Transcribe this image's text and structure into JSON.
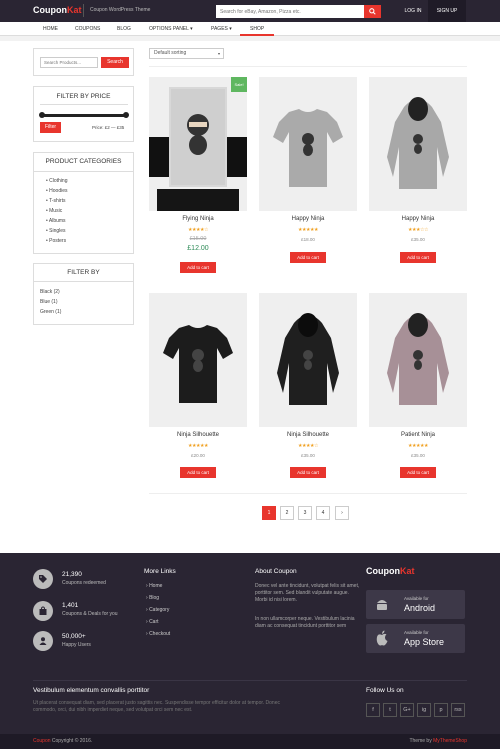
{
  "header": {
    "logo_main": "Coupon",
    "logo_accent": "Kat",
    "tagline": "Coupon WordPress Theme",
    "search_placeholder": "Search for eBay, Amazon, Pizza etc.",
    "login": "LOG IN",
    "signup": "SIGN UP",
    "accent_color": "#e8352d"
  },
  "nav": {
    "items": [
      "HOME",
      "COUPONS",
      "BLOG",
      "OPTIONS PANEL ▾",
      "PAGES ▾",
      "SHOP"
    ],
    "active": "SHOP"
  },
  "sidebar": {
    "search_placeholder": "Search Products...",
    "search_button": "Search",
    "price_title": "FILTER BY PRICE",
    "filter_button": "Filter",
    "price_range": "Price: £2 — £35",
    "categories_title": "PRODUCT CATEGORIES",
    "categories": [
      "Clothing",
      "Hoodies",
      "T-shirts",
      "Music",
      "Albums",
      "Singles",
      "Posters"
    ],
    "filter_title": "FILTER BY",
    "filters": [
      "Black (2)",
      "Blue (1)",
      "Green (1)"
    ]
  },
  "shop": {
    "sort_label": "Default sorting",
    "sale_badge": "Sale!",
    "add_to_cart": "Add to cart",
    "products": [
      {
        "name": "Flying Ninja",
        "rating": "★★★★☆",
        "old_price": "£15.00",
        "price": "£12.00"
      },
      {
        "name": "Happy Ninja",
        "rating": "★★★★★",
        "price": "£18.00"
      },
      {
        "name": "Happy Ninja",
        "rating": "★★★☆☆",
        "price": "£35.00"
      },
      {
        "name": "Ninja Silhouette",
        "rating": "★★★★★",
        "price": "£20.00"
      },
      {
        "name": "Ninja Silhouette",
        "rating": "★★★★☆",
        "price": "£35.00"
      },
      {
        "name": "Patient Ninja",
        "rating": "★★★★★",
        "price": "£35.00"
      }
    ],
    "pagination": [
      "1",
      "2",
      "3",
      "4",
      "›"
    ]
  },
  "footer": {
    "stats": [
      {
        "num": "21,390",
        "label": "Coupons redeemed"
      },
      {
        "num": "1,401",
        "label": "Coupons & Deals for you"
      },
      {
        "num": "50,000+",
        "label": "Happy Users"
      }
    ],
    "more_links_title": "More Links",
    "more_links": [
      "Home",
      "Blog",
      "Category",
      "Cart",
      "Checkout"
    ],
    "about_title": "About Coupon",
    "about_text_1": "Donec vel ante tincidunt, volutpat felis sit amet, porttitor sem. Sed blandit vulputate augue. Morbi id nisi lorem.",
    "about_text_2": "In non ullamcorper neque. Vestibulum lacinia diam ac consequat tincidunt porttitor sem",
    "android_small": "Available for",
    "android_big": "Android",
    "appstore_small": "Available for",
    "appstore_big": "App Store",
    "bottom_title": "Vestibulum elementum convallis porttitor",
    "bottom_text": "Ut placerat consequat diam, sed placerat justo sagittis nec. Suspendisse tempor efficitur dolor at tempor. Donec commodo, orci, dui nibh imperdiet neque, sed volutpat orci sem nec est.",
    "follow_title": "Follow Us on",
    "social_icons": [
      "f",
      "t",
      "G+",
      "ig",
      "p",
      "rss"
    ]
  },
  "copyright": {
    "brand": "Coupon",
    "text": " Copyright © 2016.",
    "theme_by": "Theme by ",
    "theme_author": "MyThemeShop"
  }
}
